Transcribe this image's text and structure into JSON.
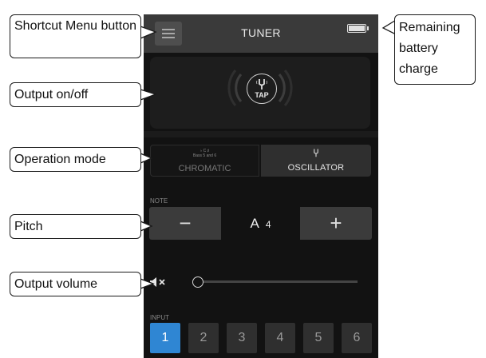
{
  "screen": {
    "title": "TUNER",
    "menu_icon": "hamburger-menu-icon",
    "battery_level": 1.0,
    "output": {
      "tap_label": "TAP",
      "icon": "tuning-fork-icon"
    },
    "mode": {
      "chromatic_label": "CHROMATIC",
      "chromatic_small_top": "♭  C  ♯",
      "chromatic_small_bottom": "Bass 5 and 6",
      "oscillator_label": "OSCILLATOR",
      "oscillator_icon": "tuning-fork-icon",
      "selected": "OSCILLATOR"
    },
    "pitch": {
      "section_label": "NOTE",
      "minus_label": "−",
      "plus_label": "+",
      "note": "A",
      "octave": "4"
    },
    "volume": {
      "mute_icon": "speaker-muted-icon",
      "level": 0.0
    },
    "input": {
      "section_label": "INPUT",
      "channels": [
        "1",
        "2",
        "3",
        "4",
        "5",
        "6"
      ],
      "selected": "1"
    }
  },
  "callouts": {
    "shortcut_menu": "Shortcut Menu button",
    "remaining_battery": "Remaining battery charge",
    "output_onoff": "Output on/off",
    "operation_mode": "Operation mode",
    "pitch": "Pitch",
    "output_volume": "Output volume"
  },
  "colors": {
    "screen_bg": "#121212",
    "titlebar_bg": "#3a3a3a",
    "accent_blue": "#2f86d3",
    "button_gray": "#3b3b3b"
  }
}
